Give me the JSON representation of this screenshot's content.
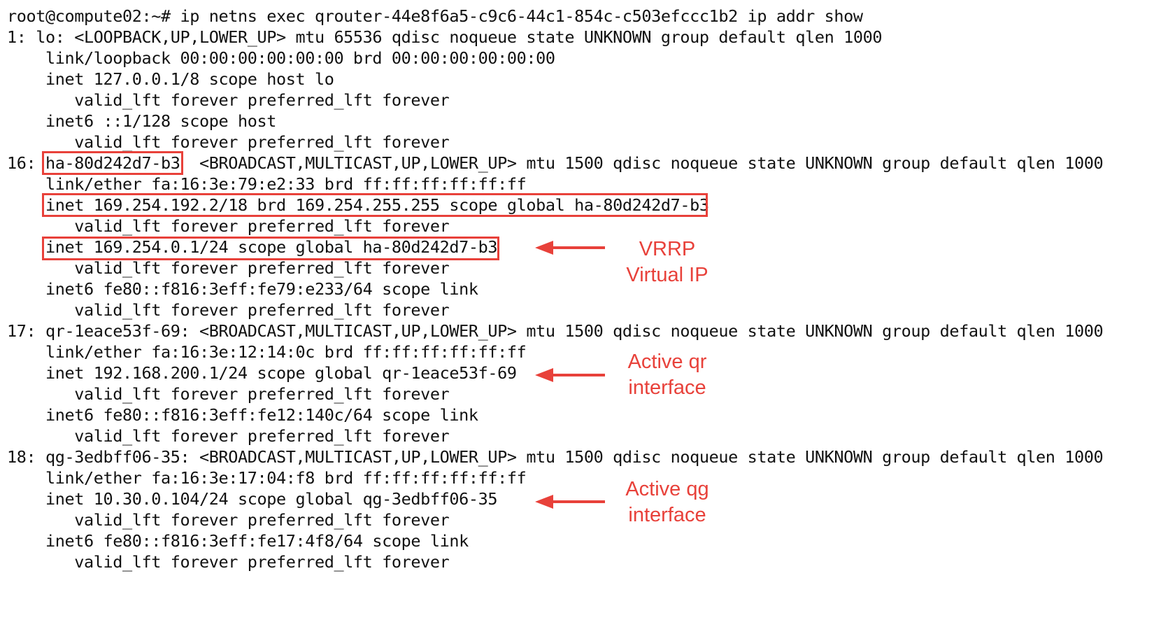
{
  "terminal": {
    "lines": [
      "root@compute02:~# ip netns exec qrouter-44e8f6a5-c9c6-44c1-854c-c503efccc1b2 ip addr show",
      "1: lo: <LOOPBACK,UP,LOWER_UP> mtu 65536 qdisc noqueue state UNKNOWN group default qlen 1000",
      "    link/loopback 00:00:00:00:00:00 brd 00:00:00:00:00:00",
      "    inet 127.0.0.1/8 scope host lo",
      "       valid_lft forever preferred_lft forever",
      "    inet6 ::1/128 scope host",
      "       valid_lft forever preferred_lft forever",
      "16: ha-80d242d7-b3  <BROADCAST,MULTICAST,UP,LOWER_UP> mtu 1500 qdisc noqueue state UNKNOWN group default qlen 1000",
      "    link/ether fa:16:3e:79:e2:33 brd ff:ff:ff:ff:ff:ff",
      "    inet 169.254.192.2/18 brd 169.254.255.255 scope global ha-80d242d7-b3",
      "       valid_lft forever preferred_lft forever",
      "    inet 169.254.0.1/24 scope global ha-80d242d7-b3",
      "       valid_lft forever preferred_lft forever",
      "    inet6 fe80::f816:3eff:fe79:e233/64 scope link",
      "       valid_lft forever preferred_lft forever",
      "17: qr-1eace53f-69: <BROADCAST,MULTICAST,UP,LOWER_UP> mtu 1500 qdisc noqueue state UNKNOWN group default qlen 1000",
      "    link/ether fa:16:3e:12:14:0c brd ff:ff:ff:ff:ff:ff",
      "    inet 192.168.200.1/24 scope global qr-1eace53f-69",
      "       valid_lft forever preferred_lft forever",
      "    inet6 fe80::f816:3eff:fe12:140c/64 scope link",
      "       valid_lft forever preferred_lft forever",
      "18: qg-3edbff06-35: <BROADCAST,MULTICAST,UP,LOWER_UP> mtu 1500 qdisc noqueue state UNKNOWN group default qlen 1000",
      "    link/ether fa:16:3e:17:04:f8 brd ff:ff:ff:ff:ff:ff",
      "    inet 10.30.0.104/24 scope global qg-3edbff06-35",
      "       valid_lft forever preferred_lft forever",
      "    inet6 fe80::f816:3eff:fe17:4f8/64 scope link",
      "       valid_lft forever preferred_lft forever"
    ]
  },
  "annotations": [
    {
      "line1": "VRRP",
      "line2": "Virtual IP"
    },
    {
      "line1": "Active qr",
      "line2": "interface"
    },
    {
      "line1": "Active qg",
      "line2": "interface"
    }
  ],
  "colors": {
    "highlight": "#e8413a",
    "text": "#111111",
    "background": "#ffffff"
  }
}
